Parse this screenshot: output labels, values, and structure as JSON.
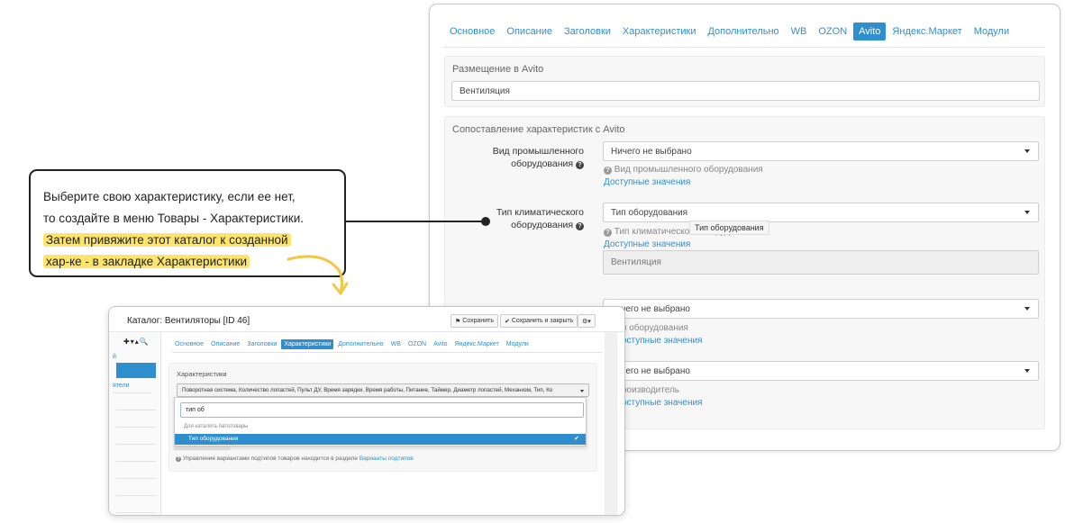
{
  "main_window": {
    "tabs": [
      {
        "label": "Основное",
        "active": false
      },
      {
        "label": "Описание",
        "active": false
      },
      {
        "label": "Заголовки",
        "active": false
      },
      {
        "label": "Характеристики",
        "active": false
      },
      {
        "label": "Дополнительно",
        "active": false
      },
      {
        "label": "WB",
        "active": false
      },
      {
        "label": "OZON",
        "active": false
      },
      {
        "label": "Avito",
        "active": true
      },
      {
        "label": "Яндекс.Маркет",
        "active": false
      },
      {
        "label": "Модули",
        "active": false
      }
    ],
    "placement": {
      "title": "Размещение в Avito",
      "value": "Вентиляция"
    },
    "mapping": {
      "title": "Сопоставление характеристик с Avito",
      "fields": [
        {
          "label_line1": "Вид промышленного",
          "label_line2": "оборудования",
          "select_value": "Ничего не выбрано",
          "help": "Вид промышленного оборудования",
          "link": "Доступные значения"
        },
        {
          "label_line1": "Тип климатического",
          "label_line2": "оборудования",
          "select_value": "Тип оборудования",
          "tooltip": "Тип оборудования",
          "help": "Тип климатического оборудования",
          "link": "Доступные значения",
          "disabled_value": "Вентиляция"
        },
        {
          "select_value": "ничего не выбрано",
          "help": "п оборудования",
          "link": "оступные значения"
        },
        {
          "select_value": "ничего не выбрано",
          "help": "роизводитель",
          "link": "оступные значения"
        }
      ]
    }
  },
  "callout": {
    "line1": "Выберите свою характеристику, если ее нет,",
    "line2": "то создайте в меню Товары - Характеристики.",
    "line3": "Затем привяжите этот каталог к созданной",
    "line4": "хар-ке - в закладке Характеристики"
  },
  "front_window": {
    "title": "Каталог: Вентиляторы [ID 46]",
    "buttons": {
      "save": "Сохранить",
      "save_close": "Сохранить и закрыть",
      "settings": "▾"
    },
    "side_tools": "✚▾▴🔍",
    "sidebar": {
      "items": [
        "й",
        "",
        "ятели",
        "",
        "",
        "",
        "",
        "",
        "",
        ""
      ]
    },
    "tabs": [
      {
        "label": "Основное",
        "active": false
      },
      {
        "label": "Описание",
        "active": false
      },
      {
        "label": "Заголовки",
        "active": false
      },
      {
        "label": "Характеристики",
        "active": true
      },
      {
        "label": "Дополнительно",
        "active": false
      },
      {
        "label": "WB",
        "active": false
      },
      {
        "label": "OZON",
        "active": false
      },
      {
        "label": "Avito",
        "active": false
      },
      {
        "label": "Яндекс.Маркет",
        "active": false
      },
      {
        "label": "Модули",
        "active": false
      }
    ],
    "panel_title": "Характеристики",
    "characteristics_value": "Поворотная система, Количество лопастей, Пульт ДУ, Время зарядки, Время работы, Питание, Таймер, Диаметр лопастей, Механизм, Тип, Ко",
    "dropdown": {
      "search_value": "тип об",
      "group": "Для каталога Автотовары",
      "option": "Тип оборудования"
    },
    "note_text": "Управление вариантами подтипов товаров находится в разделе",
    "note_link": "Варианты подтипов"
  },
  "colors": {
    "accent": "#2f8fce",
    "highlight": "#fde46a"
  }
}
